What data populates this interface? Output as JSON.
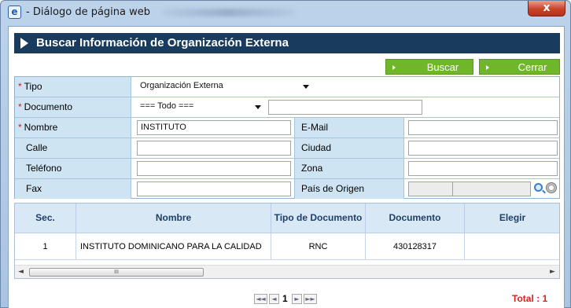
{
  "window": {
    "title": "- Diálogo de página web",
    "close_label": "x"
  },
  "header": {
    "title": "Buscar Información de Organización Externa"
  },
  "toolbar": {
    "buscar_label": "Buscar",
    "cerrar_label": "Cerrar"
  },
  "form": {
    "required_mark": "*",
    "tipo_label": "Tipo",
    "tipo_value": "Organización Externa",
    "documento_label": "Documento",
    "documento_value": "=== Todo ===",
    "documento_text": "",
    "nombre_label": "Nombre",
    "nombre_value": "INSTITUTO",
    "email_label": "E-Mail",
    "email_value": "",
    "calle_label": "Calle",
    "calle_value": "",
    "ciudad_label": "Ciudad",
    "ciudad_value": "",
    "telefono_label": "Teléfono",
    "telefono_value": "",
    "zona_label": "Zona",
    "zona_value": "",
    "fax_label": "Fax",
    "fax_value": "",
    "pais_label": "País de Origen",
    "pais_code": "",
    "pais_name": ""
  },
  "grid": {
    "columns": {
      "sec": "Sec.",
      "nombre": "Nombre",
      "tipo_doc": "Tipo de Documento",
      "documento": "Documento",
      "elegir": "Elegir"
    },
    "rows": [
      {
        "sec": "1",
        "nombre": "INSTITUTO DOMINICANO PARA LA CALIDAD",
        "tipo_doc": "RNC",
        "documento": "430128317",
        "elegir": ""
      }
    ]
  },
  "scrollbar": {
    "left_arrow": "◄",
    "right_arrow": "►",
    "thumb_grip": "III"
  },
  "pager": {
    "first": "◄◄",
    "prev": "◄",
    "current_page": "1",
    "next": "►",
    "last": "►►",
    "total_text": "Total : 1"
  },
  "icons": {
    "lookup": "magnifier-icon",
    "clear": "clear-icon"
  }
}
